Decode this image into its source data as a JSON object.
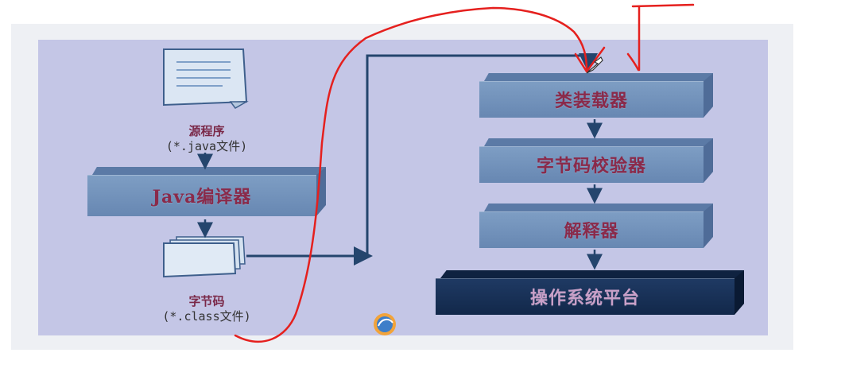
{
  "diagram": {
    "source_label": "源程序",
    "source_sub": "(*.java文件)",
    "compiler_label": "Java编译器",
    "bytecode_label": "字节码",
    "bytecode_sub": "(*.class文件)",
    "class_loader_label": "类装载器",
    "verifier_label": "字节码校验器",
    "interpreter_label": "解释器",
    "os_platform_label": "操作系统平台"
  },
  "colors": {
    "panel_bg": "#c4c6e6",
    "block_blue": "#7394bd",
    "block_dark": "#162e52",
    "arrow": "#24456d",
    "label_text": "#8a2a4a",
    "annotation_red": "#e5201e"
  },
  "icons": [
    "document-icon",
    "stacked-pages-icon",
    "arrow-down-icon",
    "cursor-icon",
    "player-logo-icon"
  ]
}
